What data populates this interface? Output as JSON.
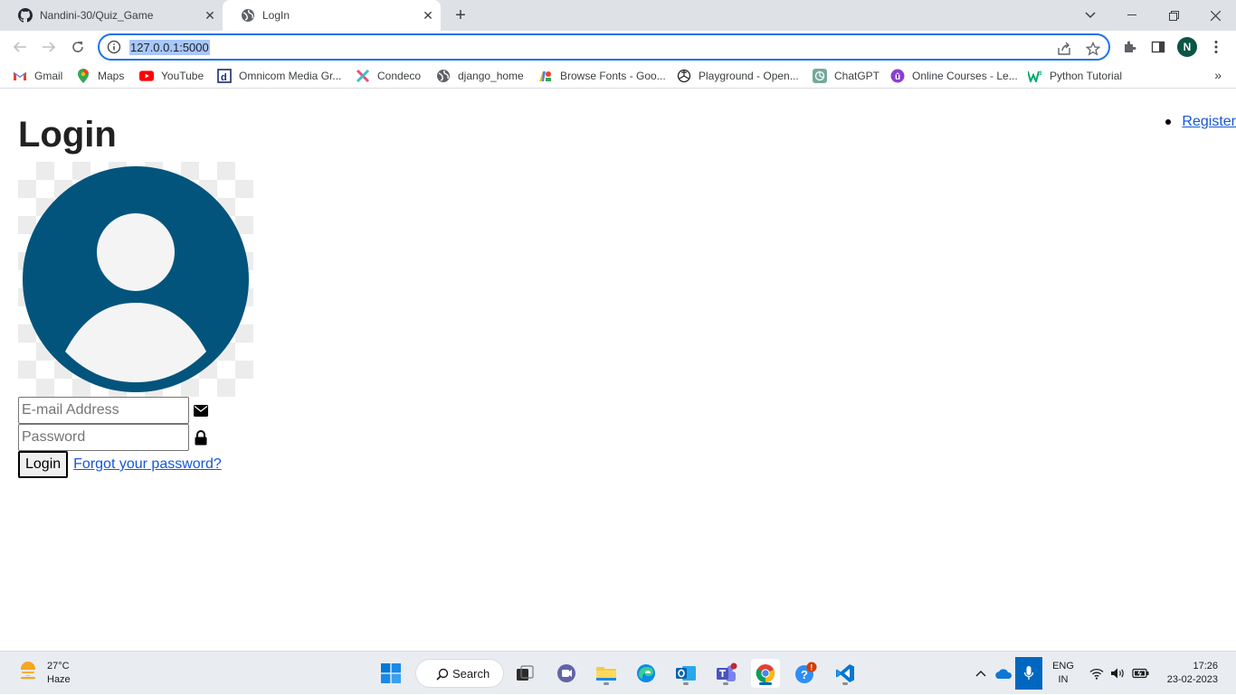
{
  "browser": {
    "tabs": [
      {
        "title": "Nandini-30/Quiz_Game",
        "icon": "github-icon"
      },
      {
        "title": "LogIn",
        "icon": "globe-icon"
      }
    ],
    "address": "127.0.0.1:5000",
    "profile_initial": "N",
    "bookmarks": [
      {
        "label": "Gmail",
        "icon": "gmail-icon"
      },
      {
        "label": "Maps",
        "icon": "maps-icon"
      },
      {
        "label": "YouTube",
        "icon": "youtube-icon"
      },
      {
        "label": "Omnicom Media Gr...",
        "icon": "omnicom-icon"
      },
      {
        "label": "Condeco",
        "icon": "condeco-icon"
      },
      {
        "label": "django_home",
        "icon": "globe-icon"
      },
      {
        "label": "Browse Fonts - Goo...",
        "icon": "google-fonts-icon"
      },
      {
        "label": "Playground - Open...",
        "icon": "openai-icon"
      },
      {
        "label": "ChatGPT",
        "icon": "chatgpt-icon"
      },
      {
        "label": "Online Courses - Le...",
        "icon": "courses-icon"
      },
      {
        "label": "Python Tutorial",
        "icon": "w3schools-icon"
      }
    ]
  },
  "page": {
    "heading": "Login",
    "nav_link": "Register",
    "email_placeholder": "E-mail Address",
    "password_placeholder": "Password",
    "login_button": "Login",
    "forgot_link": "Forgot your password?",
    "avatar_color": "#03547c"
  },
  "taskbar": {
    "temperature": "27°C",
    "condition": "Haze",
    "search_label": "Search",
    "language": "ENG",
    "region": "IN",
    "time": "17:26",
    "date": "23-02-2023"
  }
}
